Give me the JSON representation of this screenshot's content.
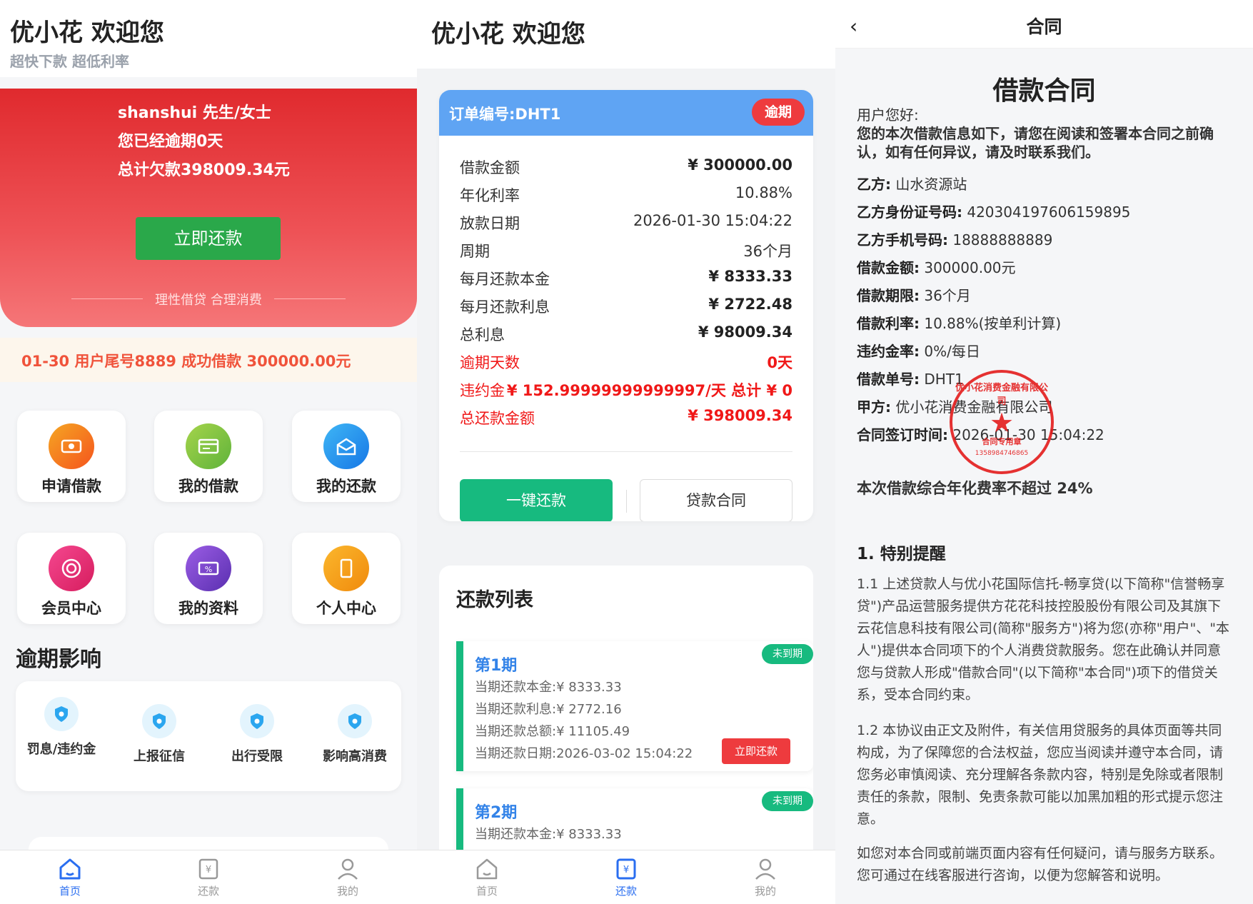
{
  "screen1": {
    "title": "优小花 欢迎您",
    "subtitle": "超快下款 超低利率",
    "hero": {
      "greeting": "shanshui 先生/女士",
      "overdue": "您已经逾期0天",
      "total": "总计欠款398009.34元",
      "button": "立即还款",
      "footer": "理性借贷 合理消费"
    },
    "notice": "01-30 用户尾号8889 成功借款 300000.00元",
    "grid": [
      {
        "label": "申请借款",
        "icon": "money-icon",
        "color": "#f5731d"
      },
      {
        "label": "我的借款",
        "icon": "card-icon",
        "color": "#7cc23e"
      },
      {
        "label": "我的还款",
        "icon": "mailbox-icon",
        "color": "#1e96f0"
      },
      {
        "label": "会员中心",
        "icon": "member-icon",
        "color": "#e8337d"
      },
      {
        "label": "我的资料",
        "icon": "ticket-icon",
        "color": "#7a3fc4"
      },
      {
        "label": "个人中心",
        "icon": "phone-icon",
        "color": "#f59a12"
      }
    ],
    "overdue_title": "逾期影响",
    "overdue_items": [
      "罚息/违约金",
      "上报征信",
      "出行受限",
      "影响高消费"
    ]
  },
  "tabbar": {
    "home": "首页",
    "repay": "还款",
    "mine": "我的"
  },
  "screen2": {
    "title": "优小花 欢迎您",
    "order_no": "订单编号:DHT1",
    "status": "逾期",
    "rows": [
      {
        "k": "借款金额",
        "v": "¥ 300000.00"
      },
      {
        "k": "年化利率",
        "v": "10.88%"
      },
      {
        "k": "放款日期",
        "v": "2026-01-30 15:04:22"
      },
      {
        "k": "周期",
        "v": "36个月"
      },
      {
        "k": "每月还款本金",
        "v": "¥ 8333.33"
      },
      {
        "k": "每月还款利息",
        "v": "¥ 2722.48"
      },
      {
        "k": "总利息",
        "v": "¥ 98009.34"
      },
      {
        "k": "逾期天数",
        "v": "0天"
      },
      {
        "k": "违约金",
        "v": "¥ 152.99999999999997/天 总计 ¥ 0"
      },
      {
        "k": "总还款金额",
        "v": "¥ 398009.34"
      }
    ],
    "btn_pay": "一键还款",
    "btn_contract": "贷款合同",
    "list_title": "还款列表",
    "periods": [
      {
        "name": "第1期",
        "status": "未到期",
        "principal": "当期还款本金:¥ 8333.33",
        "interest": "当期还款利息:¥ 2772.16",
        "total": "当期还款总额:¥ 11105.49",
        "date": "当期还款日期:2026-03-02 15:04:22",
        "button": "立即还款"
      },
      {
        "name": "第2期",
        "status": "未到期",
        "principal": "当期还款本金:¥ 8333.33"
      }
    ]
  },
  "screen3": {
    "back": "‹",
    "header": "合同",
    "title": "借款合同",
    "greeting": "用户您好:",
    "intro": "您的本次借款信息如下，请您在阅读和签署本合同之前确认，如有任何异议，请及时联系我们。",
    "fields": [
      {
        "label": "乙方:",
        "value": " 山水资源站"
      },
      {
        "label": "乙方身份证号码:",
        "value": " 420304197606159895"
      },
      {
        "label": "乙方手机号码:",
        "value": " 18888888889"
      },
      {
        "label": "借款金额:",
        "value": " 300000.00元"
      },
      {
        "label": "借款期限:",
        "value": " 36个月"
      },
      {
        "label": "借款利率:",
        "value": " 10.88%(按单利计算)"
      },
      {
        "label": "违约金率:",
        "value": " 0%/每日"
      },
      {
        "label": "借款单号:",
        "value": " DHT1"
      },
      {
        "label": "甲方:",
        "value": " 优小花消费金融有限公司"
      },
      {
        "label": "合同签订时间:",
        "value": " 2026-01-30 15:04:22"
      }
    ],
    "rate_note": "本次借款综合年化费率不超过 24%",
    "section1": "1. 特别提醒",
    "para1": "1.1 上述贷款人与优小花国际信托-畅享贷(以下简称\"信誉畅享贷\")产品运营服务提供方花花科技控股股份有限公司及其旗下云花信息科技有限公司(简称\"服务方\")将为您(亦称\"用户\"、\"本人\")提供本合同项下的个人消费贷款服务。您在此确认并同意您与贷款人形成\"借款合同\"(以下简称\"本合同\")项下的借贷关系，受本合同约束。",
    "para2": "1.2 本协议由正文及附件，有关信用贷服务的具体页面等共同构成，为了保障您的合法权益，您应当阅读并遵守本合同，请您务必审慎阅读、充分理解各条款内容，特别是免除或者限制责任的条款，限制、免责条款可能以加黑加粗的形式提示您注意。",
    "para3": "如您对本合同或前端页面内容有任何疑问，请与服务方联系。您可通过在线客服进行咨询，以便为您解答和说明。",
    "seal": {
      "ring": "优小花消费金融有限公司",
      "text": "合同专用章",
      "number": "1358984746865"
    }
  }
}
